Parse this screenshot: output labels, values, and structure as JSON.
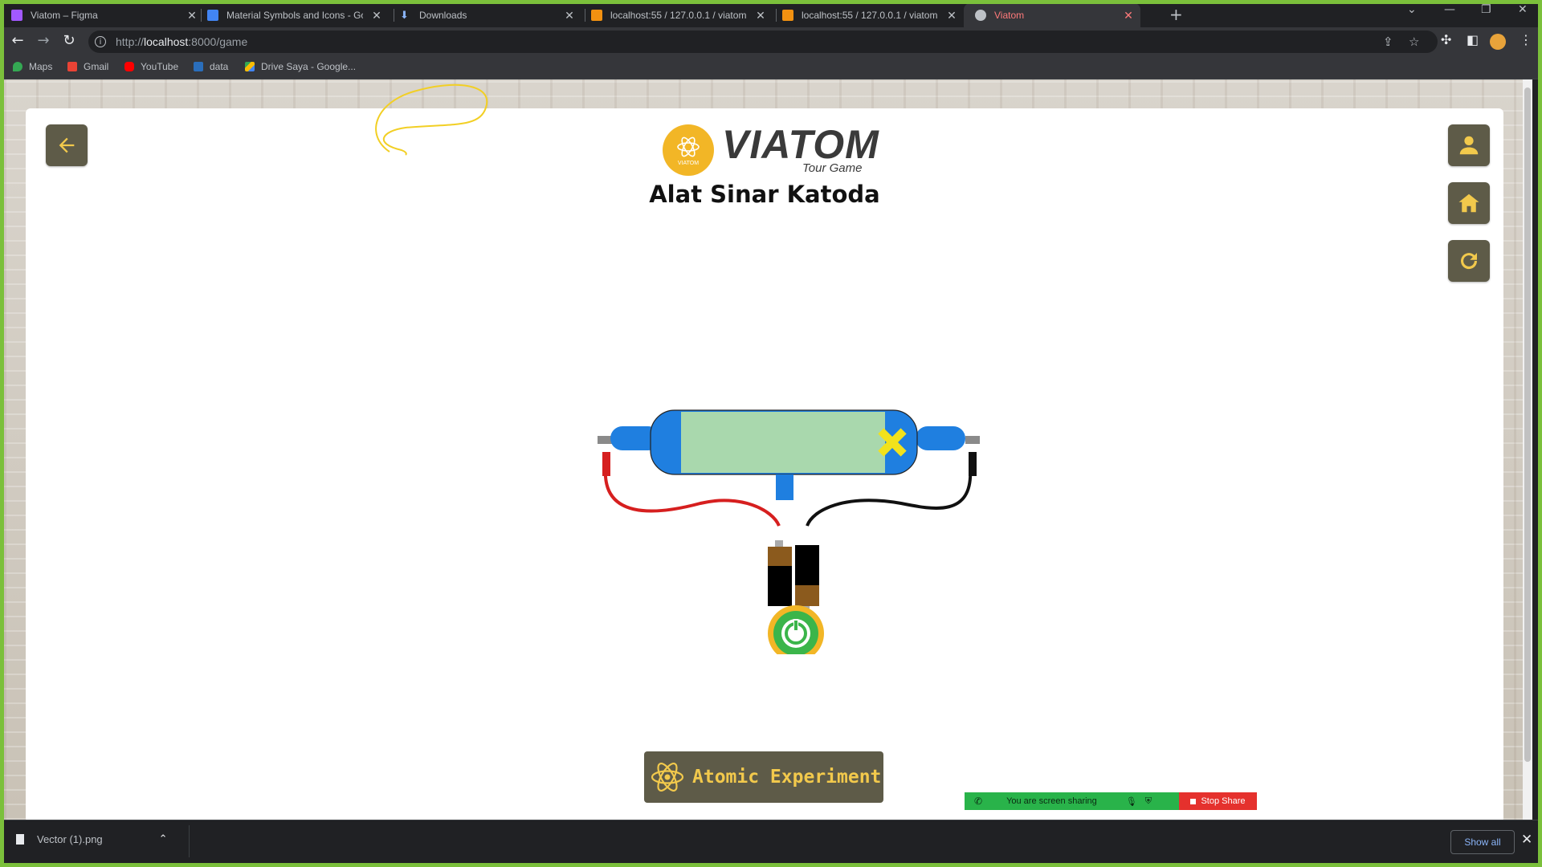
{
  "browser": {
    "tabs": [
      {
        "title": "Viatom – Figma",
        "favicon_color": "#a259ff"
      },
      {
        "title": "Material Symbols and Icons - Go",
        "favicon_color": "#4285f4"
      },
      {
        "title": "Downloads",
        "favicon_color": "#8ab4f8"
      },
      {
        "title": "localhost:55 / 127.0.0.1 / viatom",
        "favicon_color": "#f29111"
      },
      {
        "title": "localhost:55 / 127.0.0.1 / viatom",
        "favicon_color": "#f29111"
      },
      {
        "title": "Viatom",
        "favicon_color": "#bdc1c6",
        "active": true
      }
    ],
    "url_prefix": "http://",
    "url_host": "localhost",
    "url_rest": ":8000/game",
    "bookmarks": [
      {
        "label": "Maps",
        "icon": "maps-icon",
        "color": "#34a853"
      },
      {
        "label": "Gmail",
        "icon": "gmail-icon",
        "color": "#ea4335"
      },
      {
        "label": "YouTube",
        "icon": "youtube-icon",
        "color": "#ff0000"
      },
      {
        "label": "data",
        "icon": "ieee-icon",
        "color": "#2a6ebb"
      },
      {
        "label": "Drive Saya - Google...",
        "icon": "drive-icon",
        "color": "#fbbc04"
      }
    ]
  },
  "game": {
    "logo_word": "VIATOM",
    "logo_subtitle": "Tour Game",
    "logo_badge_text": "VIATOM",
    "title": "Alat Sinar Katoda",
    "atomic_button_label": "Atomic Experiment",
    "colors": {
      "button_bg": "#5e5b48",
      "accent_yellow": "#f2c94c",
      "tube_blue": "#1f7fe0",
      "tube_fill": "#a9d8ad",
      "power_green": "#3bb54a",
      "power_ring": "#f2b626"
    }
  },
  "share_bar": {
    "message": "You are screen sharing",
    "stop_label": "Stop Share"
  },
  "downloads": {
    "file_name": "Vector (1).png",
    "show_all_label": "Show all"
  }
}
